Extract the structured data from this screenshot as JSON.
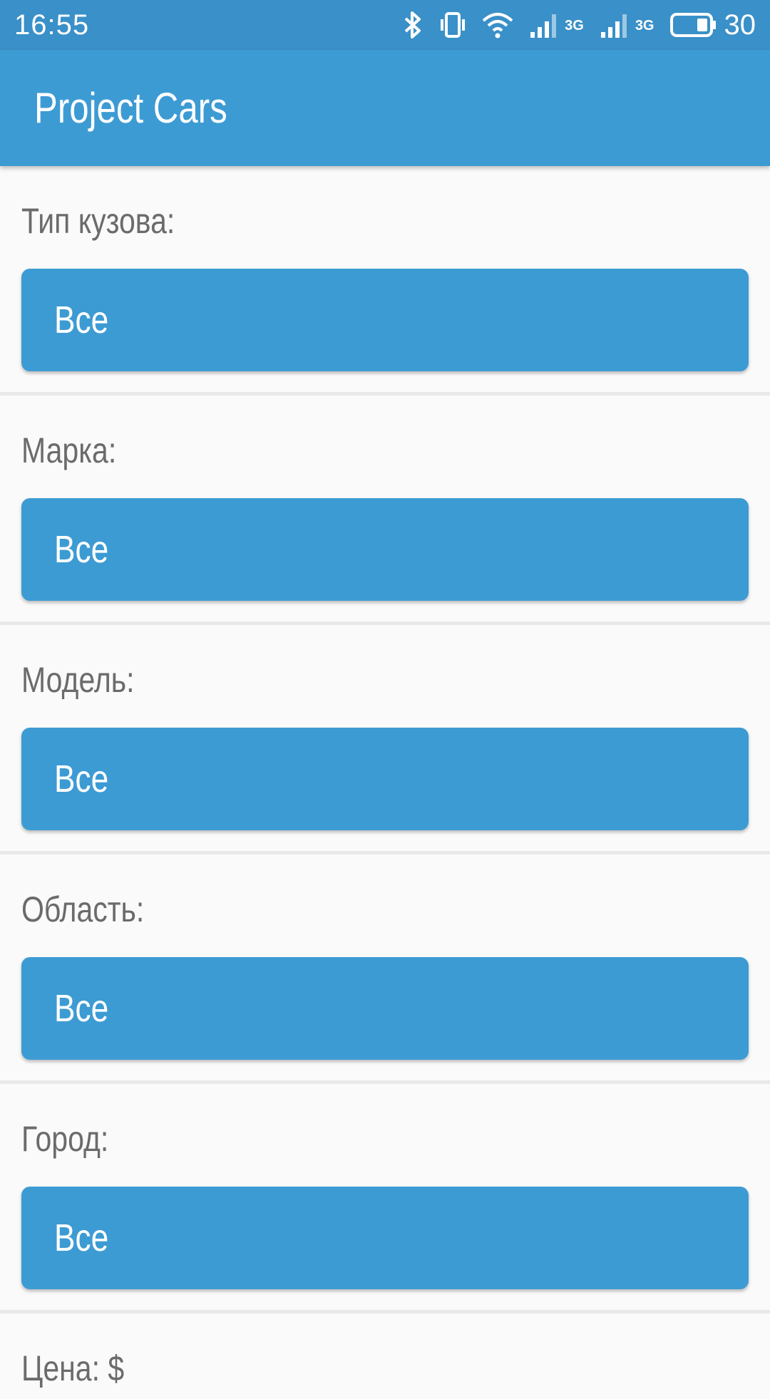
{
  "status_bar": {
    "time": "16:55",
    "network_1": "3G",
    "network_2": "3G",
    "battery_percent": "30",
    "icons": [
      "bluetooth-icon",
      "vibrate-icon",
      "wifi-icon",
      "signal-icon",
      "signal-icon",
      "battery-icon"
    ]
  },
  "app_bar": {
    "title": "Project Cars"
  },
  "filters": [
    {
      "label": "Тип кузова:",
      "value": "Все"
    },
    {
      "label": "Марка:",
      "value": "Все"
    },
    {
      "label": "Модель:",
      "value": "Все"
    },
    {
      "label": "Область:",
      "value": "Все"
    },
    {
      "label": "Город:",
      "value": "Все"
    },
    {
      "label": "Цена: $"
    }
  ],
  "colors": {
    "status_bar": "#3a90c8",
    "primary": "#3d9bd4",
    "background": "#fafafa",
    "label_text": "#6b6b6b",
    "divider": "#e9e9e9"
  }
}
